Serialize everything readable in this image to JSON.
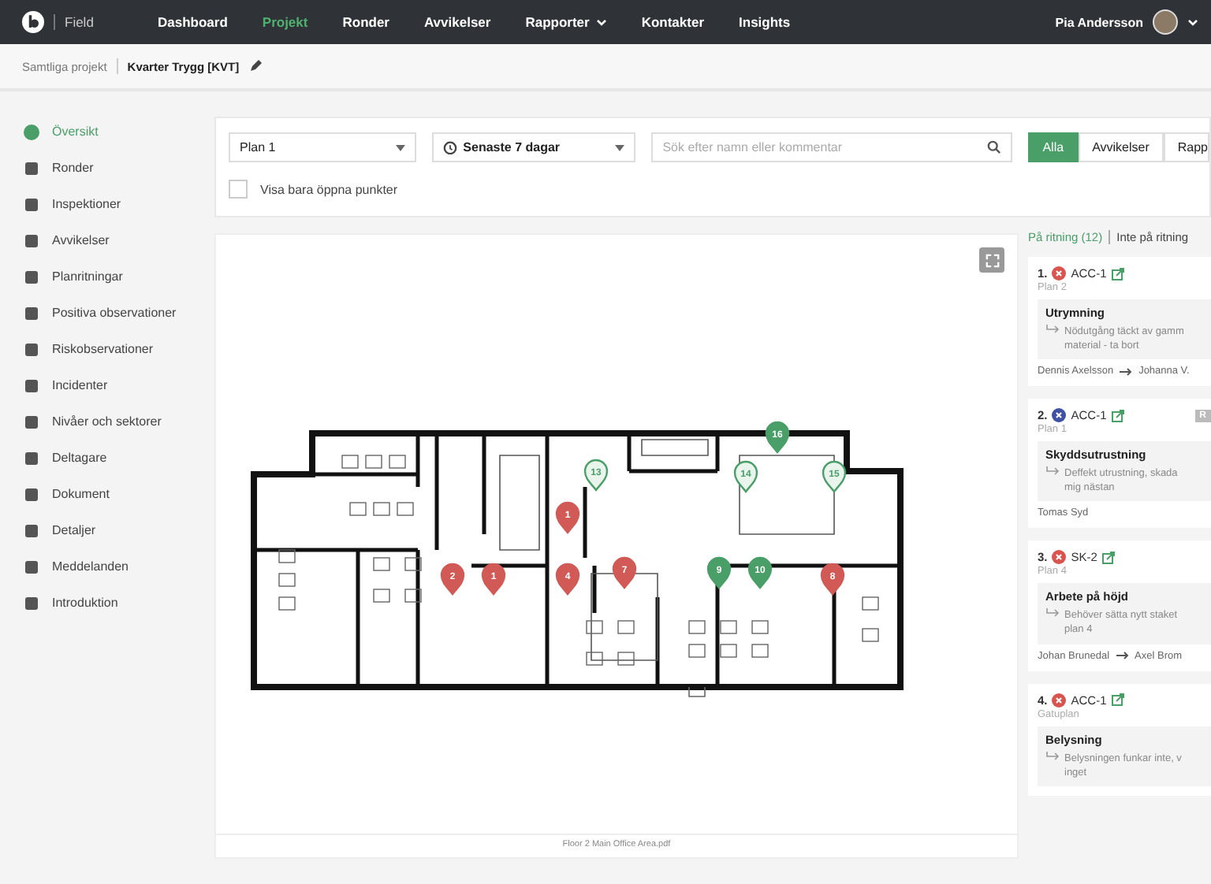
{
  "header": {
    "app_name": "Field",
    "nav": [
      {
        "label": "Dashboard",
        "selected": false,
        "dropdown": false
      },
      {
        "label": "Projekt",
        "selected": true,
        "dropdown": false
      },
      {
        "label": "Ronder",
        "selected": false,
        "dropdown": false
      },
      {
        "label": "Avvikelser",
        "selected": false,
        "dropdown": false
      },
      {
        "label": "Rapporter",
        "selected": false,
        "dropdown": true
      },
      {
        "label": "Kontakter",
        "selected": false,
        "dropdown": false
      },
      {
        "label": "Insights",
        "selected": false,
        "dropdown": false
      }
    ],
    "user": "Pia Andersson"
  },
  "breadcrumb": {
    "parent": "Samtliga projekt",
    "current": "Kvarter Trygg [KVT]"
  },
  "sidebar": {
    "items": [
      {
        "label": "Översikt",
        "selected": true
      },
      {
        "label": "Ronder",
        "selected": false
      },
      {
        "label": "Inspektioner",
        "selected": false
      },
      {
        "label": "Avvikelser",
        "selected": false
      },
      {
        "label": "Planritningar",
        "selected": false
      },
      {
        "label": "Positiva observationer",
        "selected": false
      },
      {
        "label": "Riskobservationer",
        "selected": false
      },
      {
        "label": "Incidenter",
        "selected": false
      },
      {
        "label": "Nivåer och sektorer",
        "selected": false
      },
      {
        "label": "Deltagare",
        "selected": false
      },
      {
        "label": "Dokument",
        "selected": false
      },
      {
        "label": "Detaljer",
        "selected": false
      },
      {
        "label": "Meddelanden",
        "selected": false
      },
      {
        "label": "Introduktion",
        "selected": false
      }
    ]
  },
  "filters": {
    "plan": "Plan 1",
    "period": "Senaste 7 dagar",
    "search": {
      "placeholder": "Sök efter namn eller kommentar"
    },
    "types": [
      {
        "label": "Alla",
        "selected": true
      },
      {
        "label": "Avvikelser",
        "selected": false
      },
      {
        "label": "Rapp",
        "selected": false
      }
    ],
    "only_open": {
      "label": "Visa bara öppna punkter",
      "checked": false
    }
  },
  "plan": {
    "file_name": "Floor 2 Main Office Area.pdf",
    "pins": [
      {
        "number": "1",
        "color": "#d25a56",
        "filled": true
      },
      {
        "number": "2",
        "color": "#d25a56",
        "filled": true
      },
      {
        "number": "1",
        "color": "#d25a56",
        "filled": true
      },
      {
        "number": "4",
        "color": "#d25a56",
        "filled": true
      },
      {
        "number": "7",
        "color": "#d25a56",
        "filled": true
      },
      {
        "number": "9",
        "color": "#4a9e68",
        "filled": true
      },
      {
        "number": "10",
        "color": "#4a9e68",
        "filled": true
      },
      {
        "number": "8",
        "color": "#d25a56",
        "filled": true
      },
      {
        "number": "13",
        "color": "#4a9e68",
        "filled": false
      },
      {
        "number": "14",
        "color": "#4a9e68",
        "filled": false
      },
      {
        "number": "15",
        "color": "#4a9e68",
        "filled": false
      },
      {
        "number": "16",
        "color": "#4a9e68",
        "filled": true
      }
    ]
  },
  "list": {
    "tabs": [
      {
        "label": "På ritning (12)",
        "selected": true
      },
      {
        "label": "Inte på ritning",
        "selected": false
      }
    ],
    "cards": [
      {
        "index": "1.",
        "color": "#d9534f",
        "code": "ACC-1",
        "location": "Plan 2",
        "category": "Utrymning",
        "comment": "Nödutgång täckt av gamm\nmaterial - ta bort",
        "reporter": "Dennis Axelsson",
        "assignee": "Johanna V."
      },
      {
        "index": "2.",
        "color": "#3f51a3",
        "code": "ACC-1",
        "badge": "R",
        "location": "Plan 1",
        "category": "Skyddsutrustning",
        "comment": "Deffekt utrustning, skada\nmig nästan",
        "reporter": "Tomas Syd"
      },
      {
        "index": "3.",
        "color": "#d9534f",
        "code": "SK-2",
        "location": "Plan 4",
        "category": "Arbete på höjd",
        "comment": "Behöver sätta nytt staket\nplan 4",
        "reporter": "Johan Brunedal",
        "assignee": "Axel Brom"
      },
      {
        "index": "4.",
        "color": "#d9534f",
        "code": "ACC-1",
        "location": "Gatuplan",
        "category": "Belysning",
        "comment": "Belysningen funkar inte, v\ninget"
      }
    ]
  }
}
